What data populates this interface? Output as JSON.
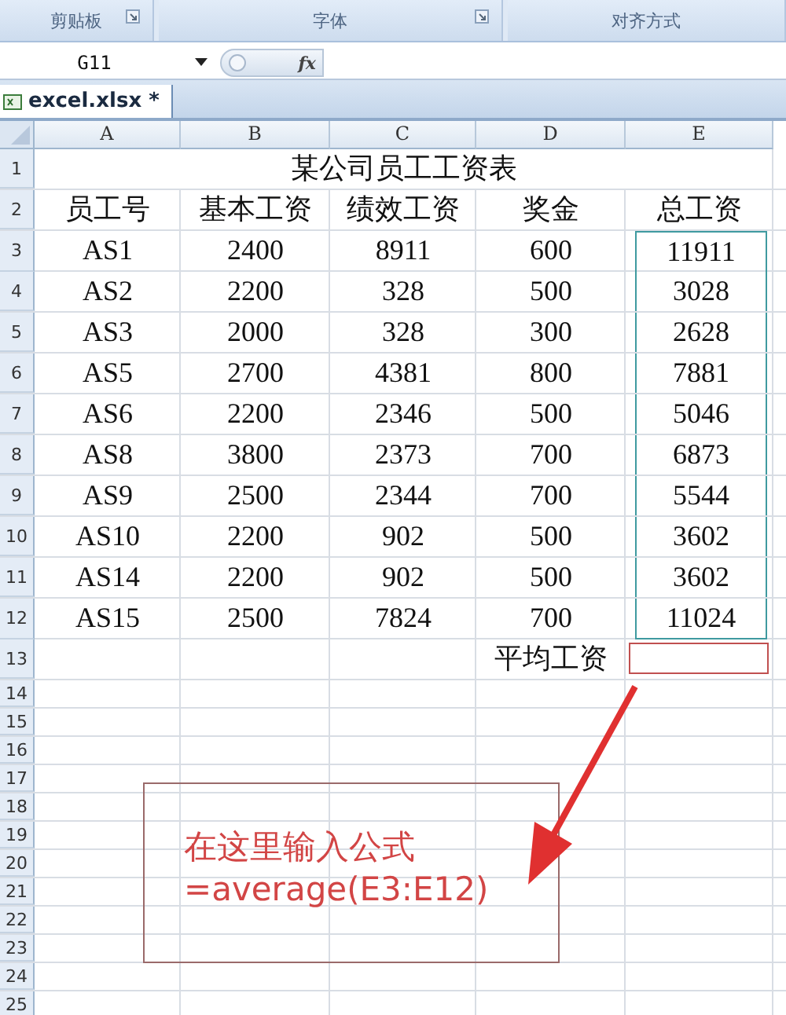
{
  "ribbon_groups": [
    {
      "label": "剪贴板",
      "launcher": true
    },
    {
      "label": "字体",
      "launcher": true
    },
    {
      "label": "对齐方式",
      "launcher": false
    }
  ],
  "name_box": "G11",
  "fx_label": "fx",
  "tabs": [
    {
      "label": "excel.xlsx *",
      "selected": true
    }
  ],
  "columns": [
    "A",
    "B",
    "C",
    "D",
    "E"
  ],
  "rows": [
    {
      "number": "1",
      "kind": "title",
      "title": "某公司员工工资表"
    },
    {
      "number": "2",
      "kind": "data",
      "cells": [
        "员工号",
        "基本工资",
        "绩效工资",
        "奖金",
        "总工资"
      ],
      "range_outlined": false
    },
    {
      "number": "3",
      "kind": "data",
      "cells": [
        "AS1",
        "2400",
        "8911",
        "600",
        "11911"
      ],
      "range_outlined": true
    },
    {
      "number": "4",
      "kind": "data",
      "cells": [
        "AS2",
        "2200",
        "328",
        "500",
        "3028"
      ],
      "range_outlined": true
    },
    {
      "number": "5",
      "kind": "data",
      "cells": [
        "AS3",
        "2000",
        "328",
        "300",
        "2628"
      ],
      "range_outlined": true
    },
    {
      "number": "6",
      "kind": "data",
      "cells": [
        "AS5",
        "2700",
        "4381",
        "800",
        "7881"
      ],
      "range_outlined": true
    },
    {
      "number": "7",
      "kind": "data",
      "cells": [
        "AS6",
        "2200",
        "2346",
        "500",
        "5046"
      ],
      "range_outlined": true
    },
    {
      "number": "8",
      "kind": "data",
      "cells": [
        "AS8",
        "3800",
        "2373",
        "700",
        "6873"
      ],
      "range_outlined": true
    },
    {
      "number": "9",
      "kind": "data",
      "cells": [
        "AS9",
        "2500",
        "2344",
        "700",
        "5544"
      ],
      "range_outlined": true
    },
    {
      "number": "10",
      "kind": "data",
      "cells": [
        "AS10",
        "2200",
        "902",
        "500",
        "3602"
      ],
      "range_outlined": true
    },
    {
      "number": "11",
      "kind": "data",
      "cells": [
        "AS14",
        "2200",
        "902",
        "500",
        "3602"
      ],
      "range_outlined": true
    },
    {
      "number": "12",
      "kind": "data",
      "cells": [
        "AS15",
        "2500",
        "7824",
        "700",
        "11024"
      ],
      "range_outlined": true
    },
    {
      "number": "13",
      "kind": "average",
      "label": "平均工资"
    },
    {
      "number": "14",
      "kind": "blank"
    },
    {
      "number": "15",
      "kind": "blank"
    },
    {
      "number": "16",
      "kind": "blank"
    },
    {
      "number": "17",
      "kind": "blank"
    },
    {
      "number": "18",
      "kind": "blank"
    },
    {
      "number": "19",
      "kind": "blank"
    },
    {
      "number": "20",
      "kind": "blank"
    },
    {
      "number": "21",
      "kind": "blank"
    },
    {
      "number": "22",
      "kind": "blank"
    },
    {
      "number": "23",
      "kind": "blank"
    },
    {
      "number": "24",
      "kind": "blank"
    },
    {
      "number": "25",
      "kind": "blank"
    }
  ],
  "callout": {
    "lines": [
      "在这里输入公式",
      "=average(E3:E12)"
    ]
  }
}
